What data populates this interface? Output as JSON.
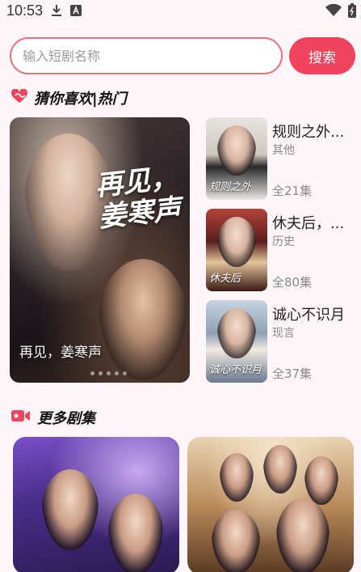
{
  "status_bar": {
    "time": "10:53",
    "icons": [
      "download-icon",
      "notification-a-icon",
      "wifi-icon",
      "battery-icon"
    ]
  },
  "search": {
    "placeholder": "输入短剧名称",
    "value": "",
    "button_label": "搜索"
  },
  "recommend_section": {
    "title": "猜你喜欢|热门",
    "icon": "heart-icon",
    "accent": "#f0435e",
    "featured": {
      "poster_title": "再见，姜寒声",
      "caption": "再见，姜寒声"
    },
    "items": [
      {
        "title": "规则之外...",
        "genre": "其他",
        "episodes": "全21集",
        "poster_text": "规则之外"
      },
      {
        "title": "休夫后，...",
        "genre": "历史",
        "episodes": "全80集",
        "poster_text": "休夫后"
      },
      {
        "title": "诚心不识月",
        "genre": "现言",
        "episodes": "全37集",
        "poster_text": "诚心不识月"
      }
    ]
  },
  "more_section": {
    "title": "更多剧集",
    "icon": "video-camera-icon"
  }
}
